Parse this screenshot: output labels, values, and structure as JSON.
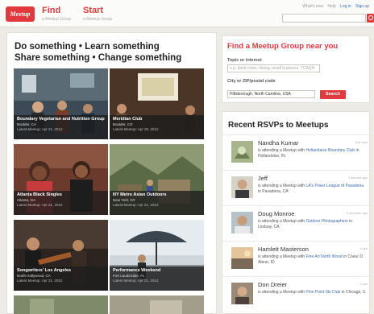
{
  "header": {
    "logo_text": "Meetup",
    "nav": [
      {
        "label": "Find",
        "sub": "a Meetup Group"
      },
      {
        "label": "Start",
        "sub": "a Meetup Group"
      }
    ],
    "top_links": {
      "what": "What's new",
      "help": "Help",
      "login": "Log in",
      "signup": "Sign up"
    }
  },
  "hero": {
    "line1": "Do something • Learn something",
    "line2": "Share something • Change something"
  },
  "tiles": [
    {
      "title": "Boundary Vegetarian and Nutrition Group",
      "location": "Boulder, CA",
      "date": "Latest Meetup: Apr 21, 2012"
    },
    {
      "title": "Meridian Club",
      "location": "Boulder, CO",
      "date": "Latest Meetup: Apr 26, 2012"
    },
    {
      "title": "Atlanta Black Singles",
      "location": "Atlanta, GA",
      "date": "Latest Meetup: Apr 21, 2012"
    },
    {
      "title": "NY Metro Asian Outdoors",
      "location": "New York, NY",
      "date": "Latest Meetup: Apr 21, 2012"
    },
    {
      "title": "Songwriters' Los Angeles",
      "location": "North Hollywood, CA",
      "date": "Latest Meetup: Apr 21, 2012"
    },
    {
      "title": "Performance Weekend",
      "location": "Fort Lauderdale, FL",
      "date": "Latest Meetup: Apr 21, 2012"
    }
  ],
  "find": {
    "title": "Find a Meetup Group near you",
    "topic_label": "Topic or interest",
    "topic_placeholder": "e.g. book clubs, hiking, small business, TCAQH",
    "city_label": "City or ZIP/postal code",
    "city_value": "Hillsborough, North Carolina, USA",
    "search_label": "Search"
  },
  "rsvps": {
    "title": "Recent RSVPs to Meetups",
    "items": [
      {
        "name": "Nandha Kumar",
        "time": "Just now",
        "pre": "is attending a Meetup with ",
        "group": "Hollandaise Boundary Club",
        "post": " in Hollandaise, IN"
      },
      {
        "name": "Jeff",
        "time": "1 second ago",
        "pre": "is attending a Meetup with ",
        "group": "LA's Poker League of Pasadena",
        "post": " in Pasadena, CA"
      },
      {
        "name": "Doug Monroe",
        "time": "2 seconds ago",
        "pre": "is attending a Meetup with ",
        "group": "Outdoor Photographers",
        "post": " in Lindsay, CA"
      },
      {
        "name": "Hamlett Masterson",
        "time": "4 sec",
        "pre": "is attending a Meetup with ",
        "group": "Fine Art North Wood",
        "post": " in Coeur D Alene, ID"
      },
      {
        "name": "Don Dreier",
        "time": "5 sec",
        "pre": "is attending a Meetup with ",
        "group": "Pine Point Ski Club",
        "post": " in Chicago, IL"
      }
    ]
  },
  "colors": {
    "brand": "#e0393e",
    "link": "#3b6bb1"
  }
}
